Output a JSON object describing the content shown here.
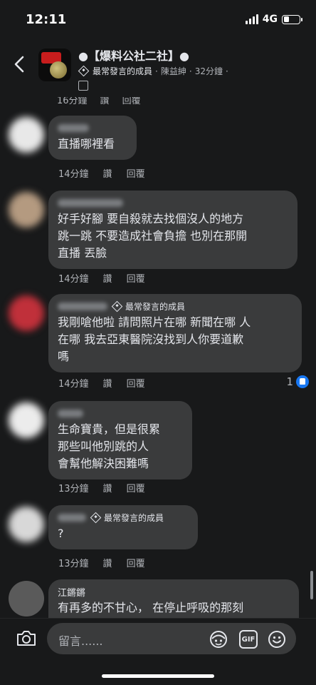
{
  "status": {
    "time": "12:11",
    "network": "4G",
    "battery_level": 0.35
  },
  "header": {
    "group_title": "●【爆料公社二社】●",
    "badge": "最常發言的成員",
    "author": "陳益紳",
    "time": "32分鐘",
    "sep": "·"
  },
  "partial": {
    "time": "16分鐘",
    "read": "讚",
    "reply": "回覆"
  },
  "comments": [
    {
      "author": "",
      "badge": "",
      "text": "直播哪裡看",
      "time": "14分鐘",
      "like": "讚",
      "reply": "回覆",
      "reactions": ""
    },
    {
      "author": "",
      "badge": "",
      "text": "好手好腳 要自殺就去找個沒人的地方\n跳一跳 不要造成社會負擔 也別在那開\n直播 丟臉",
      "time": "14分鐘",
      "like": "讚",
      "reply": "回覆",
      "reactions": ""
    },
    {
      "author": "",
      "badge": "最常發言的成員",
      "text": "我剛嗆他啦 請問照片在哪 新聞在哪 人\n在哪 我去亞東醫院沒找到人你要道歉\n嗎",
      "time": "14分鐘",
      "like": "讚",
      "reply": "回覆",
      "reactions": "1"
    },
    {
      "author": "",
      "badge": "",
      "text": "生命寶貴，但是很累\n那些叫他別跳的人\n會幫他解決困難嗎",
      "time": "13分鐘",
      "like": "讚",
      "reply": "回覆",
      "reactions": ""
    },
    {
      "author": "",
      "badge": "最常發言的成員",
      "text": "?",
      "time": "13分鐘",
      "like": "讚",
      "reply": "回覆",
      "reactions": ""
    },
    {
      "author": "江鏘鏘",
      "badge": "",
      "text": "有再多的不甘心，  在停止呼吸的那刻",
      "time": "",
      "like": "",
      "reply": "",
      "reactions": ""
    }
  ],
  "composer": {
    "placeholder": "留言......",
    "gif": "GIF"
  },
  "icons": {
    "back": "chevron-left-icon",
    "camera": "camera-icon",
    "avatar_sticker": "avatar-sticker-icon",
    "gif": "gif-icon",
    "emoji": "smile-icon",
    "like": "thumbs-up-icon",
    "badge": "diamond-badge-icon"
  }
}
